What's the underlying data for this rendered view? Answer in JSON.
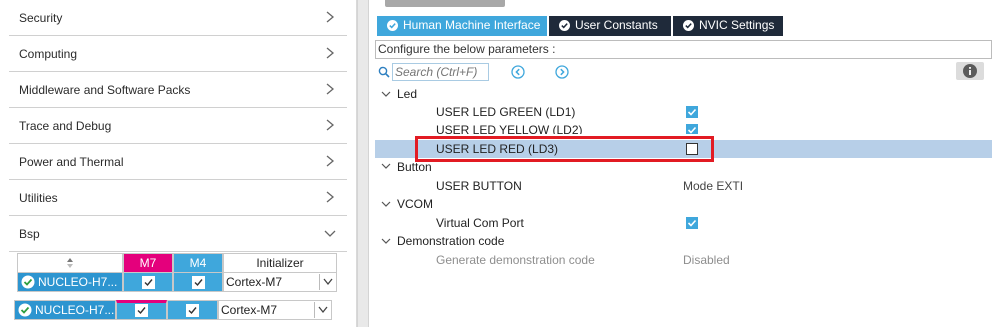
{
  "categories": [
    {
      "label": "Security"
    },
    {
      "label": "Computing"
    },
    {
      "label": "Middleware and Software Packs"
    },
    {
      "label": "Trace and Debug"
    },
    {
      "label": "Power and Thermal"
    },
    {
      "label": "Utilities"
    },
    {
      "label": "Bsp",
      "expanded": true
    }
  ],
  "bsp_table": {
    "headers": {
      "m7": "M7",
      "m4": "M4",
      "initializer": "Initializer"
    },
    "rows": [
      {
        "name": "NUCLEO-H7...",
        "m7_checked": true,
        "m4_checked": true,
        "initializer": "Cortex-M7"
      },
      {
        "name": "NUCLEO-H7...",
        "m7_checked": true,
        "m4_checked": true,
        "initializer": "Cortex-M7"
      }
    ]
  },
  "tabs": [
    {
      "label": "Human Machine Interface",
      "active": true
    },
    {
      "label": "User Constants",
      "active": false
    },
    {
      "label": "NVIC Settings",
      "active": false
    }
  ],
  "configure_label": "Configure the below parameters :",
  "search": {
    "placeholder": "Search (Ctrl+F)"
  },
  "tree": {
    "groups": {
      "led": "Led",
      "button": "Button",
      "vcom": "VCOM",
      "demo": "Demonstration code"
    },
    "params": {
      "led_green": {
        "label": "USER LED GREEN (LD1)",
        "checked": true
      },
      "led_yellow": {
        "label": "USER LED YELLOW (LD2)",
        "checked": true
      },
      "led_red": {
        "label": "USER LED RED (LD3)",
        "checked": false
      },
      "user_button": {
        "label": "USER BUTTON",
        "value": "Mode EXTI"
      },
      "virtual_com": {
        "label": "Virtual Com Port",
        "checked": true
      },
      "gen_demo": {
        "label": "Generate demonstration code",
        "value": "Disabled"
      }
    }
  },
  "colors": {
    "accent_blue": "#3fa7dc",
    "dark_tab": "#1f2a3a",
    "m7_magenta": "#e4007c",
    "highlight_red": "#e21b23",
    "selected_row": "#b7cfe8"
  },
  "icons": {
    "chevron": "chevron-right-icon",
    "expanded": "chevron-down-icon",
    "ok": "check-circle-icon",
    "search": "search-icon",
    "prev": "arrow-left-circle-icon",
    "next": "arrow-right-circle-icon",
    "info": "info-icon"
  }
}
